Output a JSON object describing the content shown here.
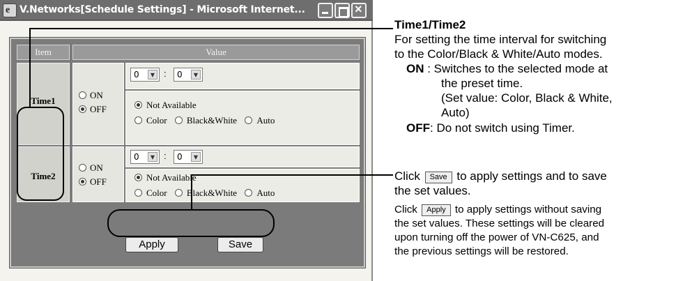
{
  "window": {
    "title": "V.Networks[Schedule Settings] - Microsoft Internet...",
    "icon": "ie-browser-icon",
    "controls": [
      "minimize-icon",
      "maximize-icon",
      "close-icon"
    ]
  },
  "table": {
    "header_item": "Item",
    "header_value": "Value",
    "rows": [
      {
        "label": "Time1",
        "on_label": "ON",
        "off_label": "OFF",
        "selected": "OFF",
        "hour": "0",
        "minute": "0",
        "mode_na": "Not Available",
        "mode_color": "Color",
        "mode_bw": "Black&White",
        "mode_auto": "Auto",
        "mode_selected": "Not Available"
      },
      {
        "label": "Time2",
        "on_label": "ON",
        "off_label": "OFF",
        "selected": "OFF",
        "hour": "0",
        "minute": "0",
        "mode_na": "Not Available",
        "mode_color": "Color",
        "mode_bw": "Black&White",
        "mode_auto": "Auto",
        "mode_selected": "Not Available"
      }
    ],
    "time_separator": ":"
  },
  "buttons": {
    "apply": "Apply",
    "save": "Save"
  },
  "annotations": {
    "title": "Time1/Time2",
    "intro_1": "For setting the time interval for switching",
    "intro_2": "to the Color/Black & White/Auto modes.",
    "on_key": "ON",
    "on_1": ": Switches to the selected mode at",
    "on_2": "the preset time.",
    "on_3": "(Set value: Color, Black & White,",
    "on_4": "Auto)",
    "off_key": "OFF",
    "off_1": ": Do not switch using Timer.",
    "save_pre": "Click",
    "save_btn": "Save",
    "save_1": "to apply settings and to save",
    "save_2": "the set values.",
    "apply_pre": "Click",
    "apply_btn": "Apply",
    "apply_1": "to apply settings without saving",
    "apply_2": "the set values. These settings will be cleared",
    "apply_3": "upon turning off the power of VN-C625, and",
    "apply_4": "the previous settings will be restored."
  }
}
